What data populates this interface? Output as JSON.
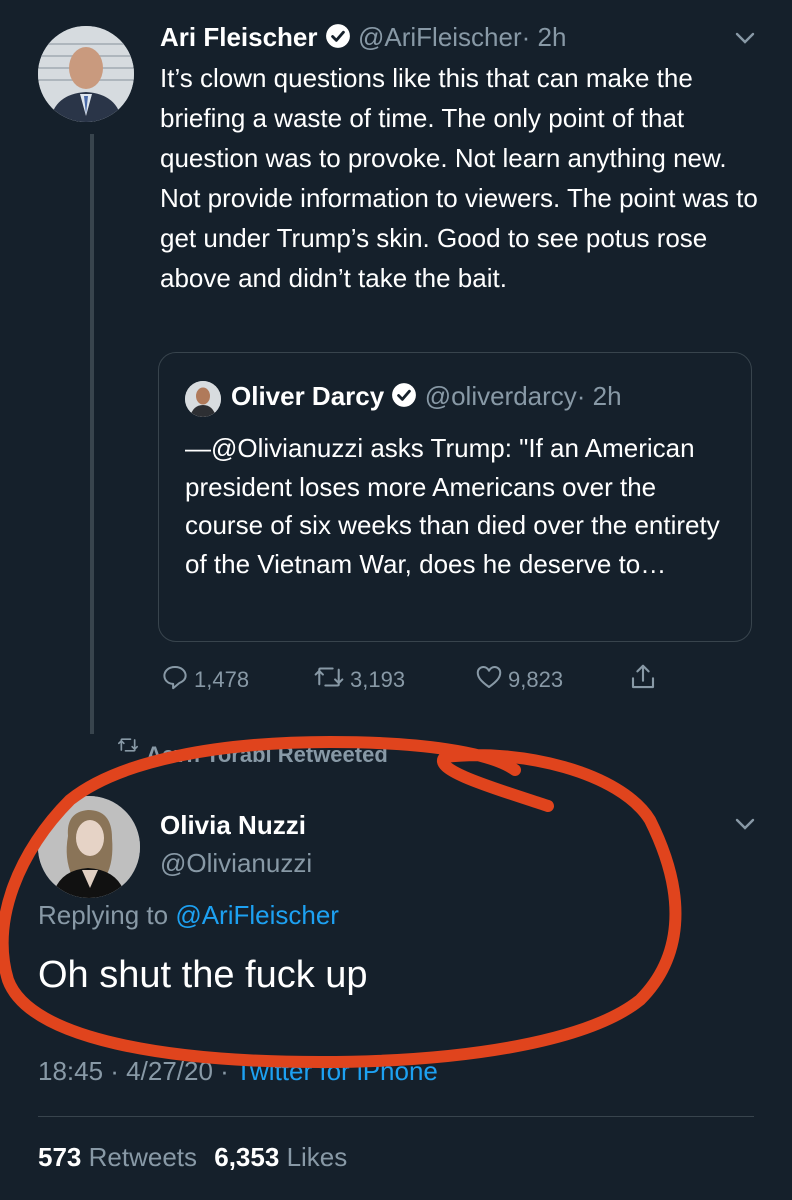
{
  "tweet1": {
    "name": "Ari Fleischer",
    "handle": "@AriFleischer",
    "time": "· 2h",
    "text": "It’s clown questions like this that can make the briefing a waste of time. The only point of that question was to provoke. Not learn anything new. Not provide information to viewers. The point was to get under Trump’s skin. Good to see potus rose above and didn’t take the bait.",
    "quote": {
      "name": "Oliver Darcy",
      "handle": "@oliverdarcy",
      "time": "· 2h",
      "text": "—@Olivianuzzi asks Trump: \"If an American president loses more Americans over the course of six weeks than died over the entirety of the Vietnam War, does he deserve to…"
    },
    "actions": {
      "replies": "1,478",
      "retweets": "3,193",
      "likes": "9,823"
    }
  },
  "retweeted_by": "Aeyn Torabi Retweeted",
  "tweet2": {
    "name": "Olivia Nuzzi",
    "handle": "@Olivianuzzi",
    "replying_prefix": "Replying to",
    "replying_handle": "@AriFleischer",
    "text": "Oh shut the fuck up",
    "time": "18:45 · 4/27/20 ·",
    "source": "Twitter for iPhone",
    "retweets_count": "573",
    "retweets_label": "Retweets",
    "likes_count": "6,353",
    "likes_label": "Likes"
  },
  "colors": {
    "background": "#15202b",
    "accent": "#1da1f2",
    "muted": "#8899a6",
    "annotation": "#e0441d"
  },
  "icons": [
    "verified-badge-icon",
    "chevron-down-icon",
    "reply-icon",
    "retweet-icon",
    "like-icon",
    "share-icon"
  ]
}
